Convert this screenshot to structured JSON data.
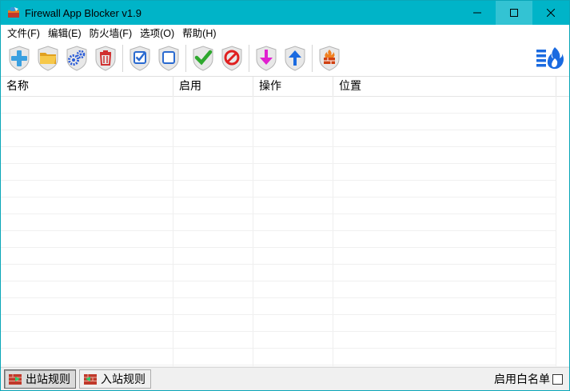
{
  "window": {
    "title": "Firewall App Blocker v1.9",
    "accent": "#00b4c8"
  },
  "menu": [
    "文件(F)",
    "编辑(E)",
    "防火墙(F)",
    "选项(O)",
    "帮助(H)"
  ],
  "toolbar": {
    "buttons": [
      "add-icon",
      "open-folder-icon",
      "settings-gears-icon",
      "delete-icon",
      "check-all-icon",
      "uncheck-all-icon",
      "enable-icon",
      "block-icon",
      "move-down-icon",
      "move-up-icon",
      "firewall-icon"
    ],
    "right_icon": "firewall-settings-icon"
  },
  "list": {
    "columns": [
      "名称",
      "启用",
      "操作",
      "位置"
    ],
    "rows": []
  },
  "bottom": {
    "tabs": [
      "出站规则",
      "入站规则"
    ],
    "active_tab": "出站规则",
    "whitelist_label": "启用白名单",
    "whitelist_checked": false
  }
}
